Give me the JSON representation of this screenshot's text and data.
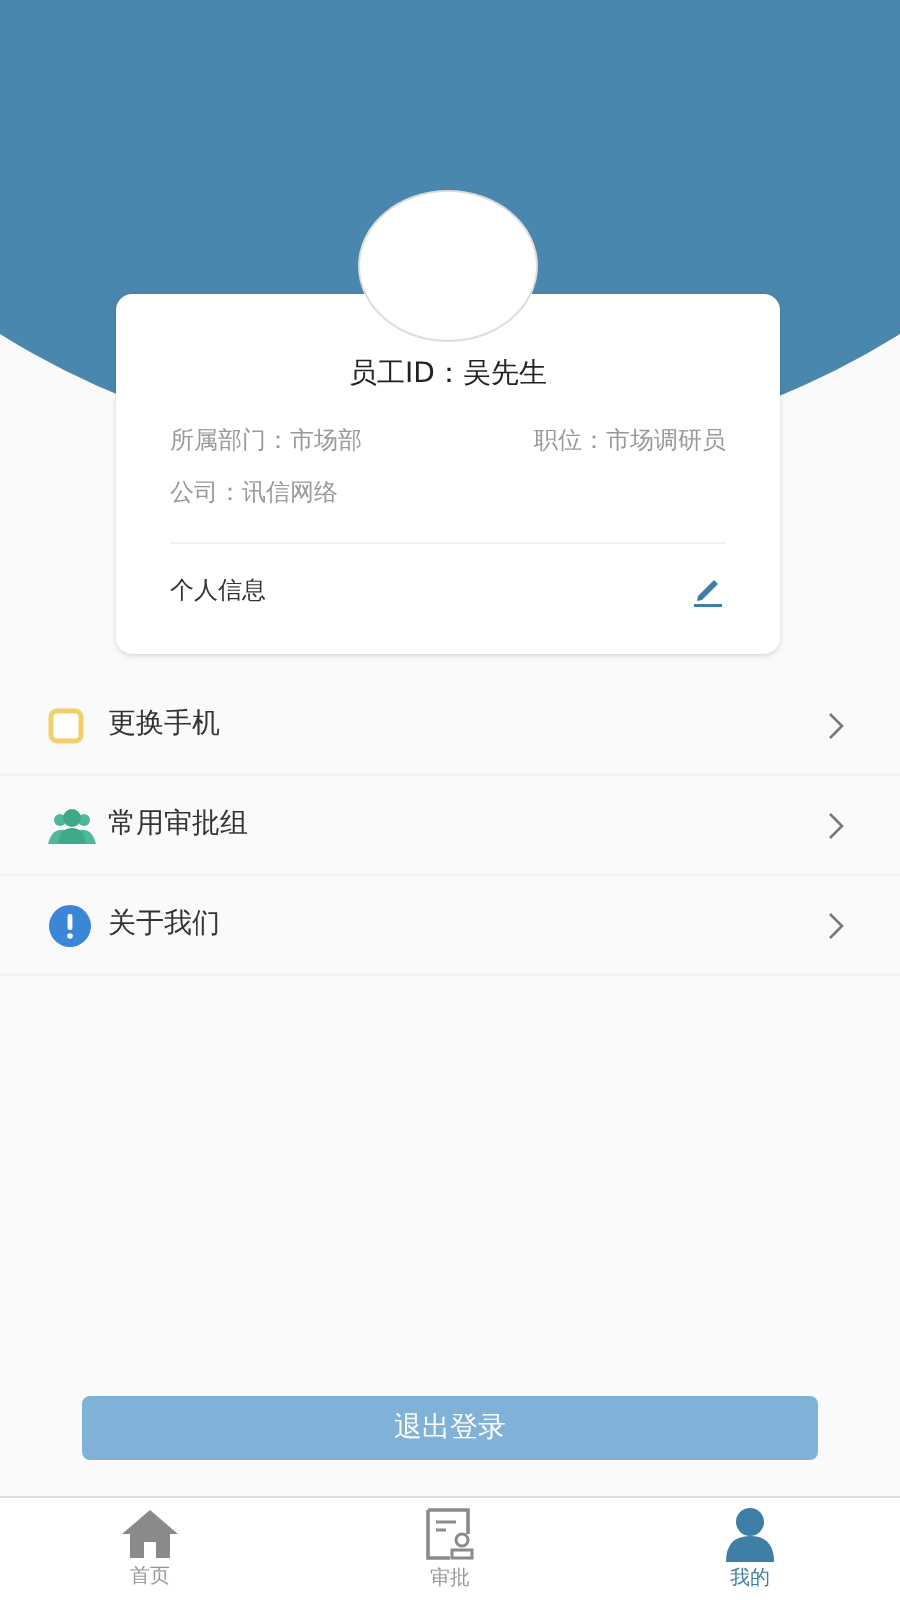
{
  "profile": {
    "employee_id": "员工ID：吴先生",
    "department": "所属部门：市场部",
    "position": "职位：市场调研员",
    "company": "公司：讯信网络",
    "info_label": "个人信息"
  },
  "menu": [
    {
      "kind": "phone",
      "label": "更换手机"
    },
    {
      "kind": "group",
      "label": "常用审批组"
    },
    {
      "kind": "info",
      "label": "关于我们"
    }
  ],
  "logout_button": "退出登录",
  "tabs": [
    {
      "kind": "home",
      "label": "首页",
      "selected": false
    },
    {
      "kind": "approval",
      "label": "审批",
      "selected": false
    },
    {
      "kind": "me",
      "label": "我的",
      "selected": true
    }
  ]
}
